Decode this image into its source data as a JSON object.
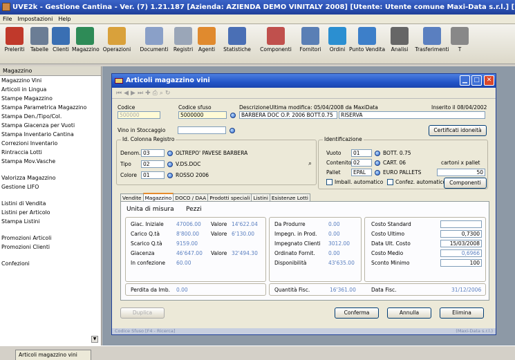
{
  "app": {
    "title": "UVE2k - Gestione Cantina - Ver. (7) 1.21.187 [Azienda: AZIENDA DEMO VINITALY 2008] [Utente: Utente comune Maxi-Data s.r.l.] [Data: 19/03/200"
  },
  "menu": [
    "File",
    "Impostazioni",
    "Help"
  ],
  "toolbar": [
    {
      "label": "Preleriti",
      "icon": "book-icon",
      "color": "#c0392b"
    },
    {
      "label": "Tabelle",
      "icon": "table-icon",
      "color": "#6b7d95"
    },
    {
      "label": "Clienti",
      "icon": "people-icon",
      "color": "#3a6fb3"
    },
    {
      "label": "Magazzino",
      "icon": "warehouse-icon",
      "color": "#2e8b57"
    },
    {
      "label": "Operazioni",
      "icon": "pencil-icon",
      "color": "#d9a13b"
    },
    {
      "label": "Documenti",
      "icon": "document-icon",
      "color": "#8aa0c8"
    },
    {
      "label": "Registri",
      "icon": "register-icon",
      "color": "#9aa6b8"
    },
    {
      "label": "Agenti",
      "icon": "agent-icon",
      "color": "#e08a2e"
    },
    {
      "label": "Statistiche",
      "icon": "chart-icon",
      "color": "#4a6fb5"
    },
    {
      "label": "Componenti",
      "icon": "component-icon",
      "color": "#c0504d"
    },
    {
      "label": "Fornitori",
      "icon": "supplier-icon",
      "color": "#5a7fb5"
    },
    {
      "label": "Ordini",
      "icon": "globe-icon",
      "color": "#2b8fd1"
    },
    {
      "label": "Punto Vendita",
      "icon": "pos-icon",
      "color": "#3d7fc9"
    },
    {
      "label": "Analisi",
      "icon": "analysis-icon",
      "color": "#666666"
    },
    {
      "label": "Trasferimenti",
      "icon": "transfer-icon",
      "color": "#5a7fc0"
    },
    {
      "label": "T",
      "icon": "more-icon",
      "color": "#888888"
    }
  ],
  "sidebar": {
    "header": "Magazzino",
    "groups": [
      [
        "Magazzino Vini",
        "Articoli in Lingua",
        "Stampe Magazzino",
        "Stampa Parametrica Magazzino",
        "Stampa Den./Tipo/Col.",
        "Stampa Giacenza per Vuoti",
        "Stampa Inventario Cantina",
        "Correzioni Inventario",
        "Rintraccia Lotti",
        "Stampa Mov.Vasche"
      ],
      [
        "Valorizza Magazzino",
        "Gestione LIFO"
      ],
      [
        "Listini di Vendita",
        "Listini per Articolo",
        "Stampa Listini"
      ],
      [
        "Promozioni Articoli",
        "Promozioni Clienti"
      ],
      [
        "Confezioni"
      ]
    ]
  },
  "window": {
    "title": "Articoli magazzino vini",
    "header": {
      "codice_label": "Codice",
      "codice_value": "500000",
      "codice_sfuso_label": "Codice sfuso",
      "codice_sfuso_value": "5000000",
      "descrizione_label": "Descrizione",
      "ultima_modifica": "Ultima modifica: 05/04/2008 da MaxiData",
      "inserito": "Inserito il 08/04/2002",
      "descrizione_value": "BARBERA DOC O.P. 2006 BOTT.0.75",
      "riserva": "RISERVA",
      "vino_stoccaggio_label": "Vino in Stoccaggio",
      "certificati_button": "Certificati idoneità"
    },
    "registro": {
      "title": "Id. Colonna Registro",
      "denom_label": "Denom.",
      "denom_code": "03",
      "denom_desc": "OLTREPO' PAVESE BARBERA",
      "tipo_label": "Tipo",
      "tipo_code": "02",
      "tipo_desc": "V.DS.DOC",
      "colore_label": "Colore",
      "colore_code": "01",
      "colore_desc": "ROSSO 2006"
    },
    "identificazione": {
      "title": "Identificazione",
      "vuoto_label": "Vuoto",
      "vuoto_code": "01",
      "vuoto_desc": "BOTT. 0.75",
      "contenitore_label": "Contenitore",
      "contenitore_code": "02",
      "contenitore_desc": "CART. 06",
      "cartoni_label": "cartoni x pallet",
      "pallet_label": "Pallet",
      "pallet_code": "EPAL",
      "pallet_desc": "EURO PALLETS",
      "pallet_qty": "50",
      "imball_label": "Imball. automatico",
      "confez_label": "Confez. automatico",
      "componenti_button": "Componenti"
    },
    "tabs": [
      "Vendite",
      "Magazzino",
      "DOCO / DAA",
      "Prodotti speciali",
      "Listini",
      "Esistenze Lotti"
    ],
    "active_tab": "Magazzino",
    "magazzino": {
      "unita_label": "Unita di misura",
      "unita_value": "Pezzi",
      "left_rows": [
        {
          "label": "Giac. Iniziale",
          "value": "47006.00",
          "vlabel": "Valore",
          "vvalue": "14'622.04"
        },
        {
          "label": "Carico Q.tà",
          "value": "8'800.00",
          "vlabel": "Valore",
          "vvalue": "6'130.00"
        },
        {
          "label": "Scarico Q.tà",
          "value": "9159.00",
          "vlabel": "",
          "vvalue": ""
        },
        {
          "label": "Giacenza",
          "value": "46'647.00",
          "vlabel": "Valore",
          "vvalue": "32'494.30"
        },
        {
          "label": "In confezione",
          "value": "60.00",
          "vlabel": "",
          "vvalue": ""
        }
      ],
      "perdita_label": "Perdita da Imb.",
      "perdita_value": "0.00",
      "mid_rows": [
        {
          "label": "Da Produrre",
          "value": "0.00"
        },
        {
          "label": "Impegn. in Prod.",
          "value": "0.00"
        },
        {
          "label": "Impegnato Clienti",
          "value": "3012.00"
        },
        {
          "label": "Ordinato Fornit.",
          "value": "0.00"
        },
        {
          "label": "Disponibilità",
          "value": "43'635.00"
        }
      ],
      "quantita_fisc_label": "Quantità Fisc.",
      "quantita_fisc_value": "16'361.00",
      "right_rows": [
        {
          "label": "Costo Standard",
          "value": ""
        },
        {
          "label": "Costo Ultimo",
          "value": "0,7300"
        },
        {
          "label": "Data Ult. Costo",
          "value": "15/03/2008"
        },
        {
          "label": "Costo Medio",
          "value": "0,6966"
        },
        {
          "label": "Sconto Minimo",
          "value": "100"
        }
      ],
      "data_fisc_label": "Data Fisc.",
      "data_fisc_value": "31/12/2006"
    },
    "buttons": {
      "duplica": "Duplica",
      "conferma": "Conferma",
      "annulla": "Annulla",
      "elimina": "Elimina"
    },
    "status_left": "Codice Sfuso [F4 - Ricerca]",
    "status_right": "(Maxi-Data s.r.l.)"
  },
  "taskbar": {
    "item": "Articoli magazzino vini"
  },
  "colors": {
    "title_blue": "#2a4fb0",
    "field_border": "#7f9db9",
    "tab_accent": "#e68b2c",
    "value_blue": "#5a7fc0"
  }
}
